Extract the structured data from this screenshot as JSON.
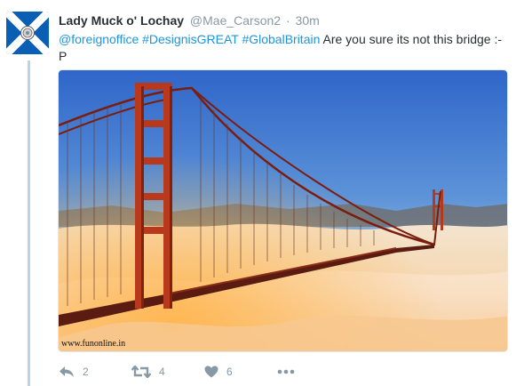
{
  "tweet": {
    "fullname": "Lady Muck o' Lochay",
    "username": "@Mae_Carson2",
    "separator": "·",
    "time": "30m",
    "mentions": "@foreignoffice",
    "hashtags": [
      "#DesignisGREAT",
      "#GlobalBritain"
    ],
    "text": "Are you sure its not this bridge :-P",
    "media": {
      "alt_icon": "golden-gate-bridge-fog-photo",
      "watermark": "www.funonline.in"
    },
    "actions": {
      "reply_icon": "reply-icon",
      "reply_count": "2",
      "retweet_icon": "retweet-icon",
      "retweet_count": "4",
      "like_icon": "heart-icon",
      "like_count": "6",
      "more_icon": "more-icon"
    }
  },
  "colors": {
    "link": "#1b95e0",
    "muted": "#8899a6",
    "thread_line": "#b4d7ee",
    "saltire_blue": "#0065bd"
  }
}
